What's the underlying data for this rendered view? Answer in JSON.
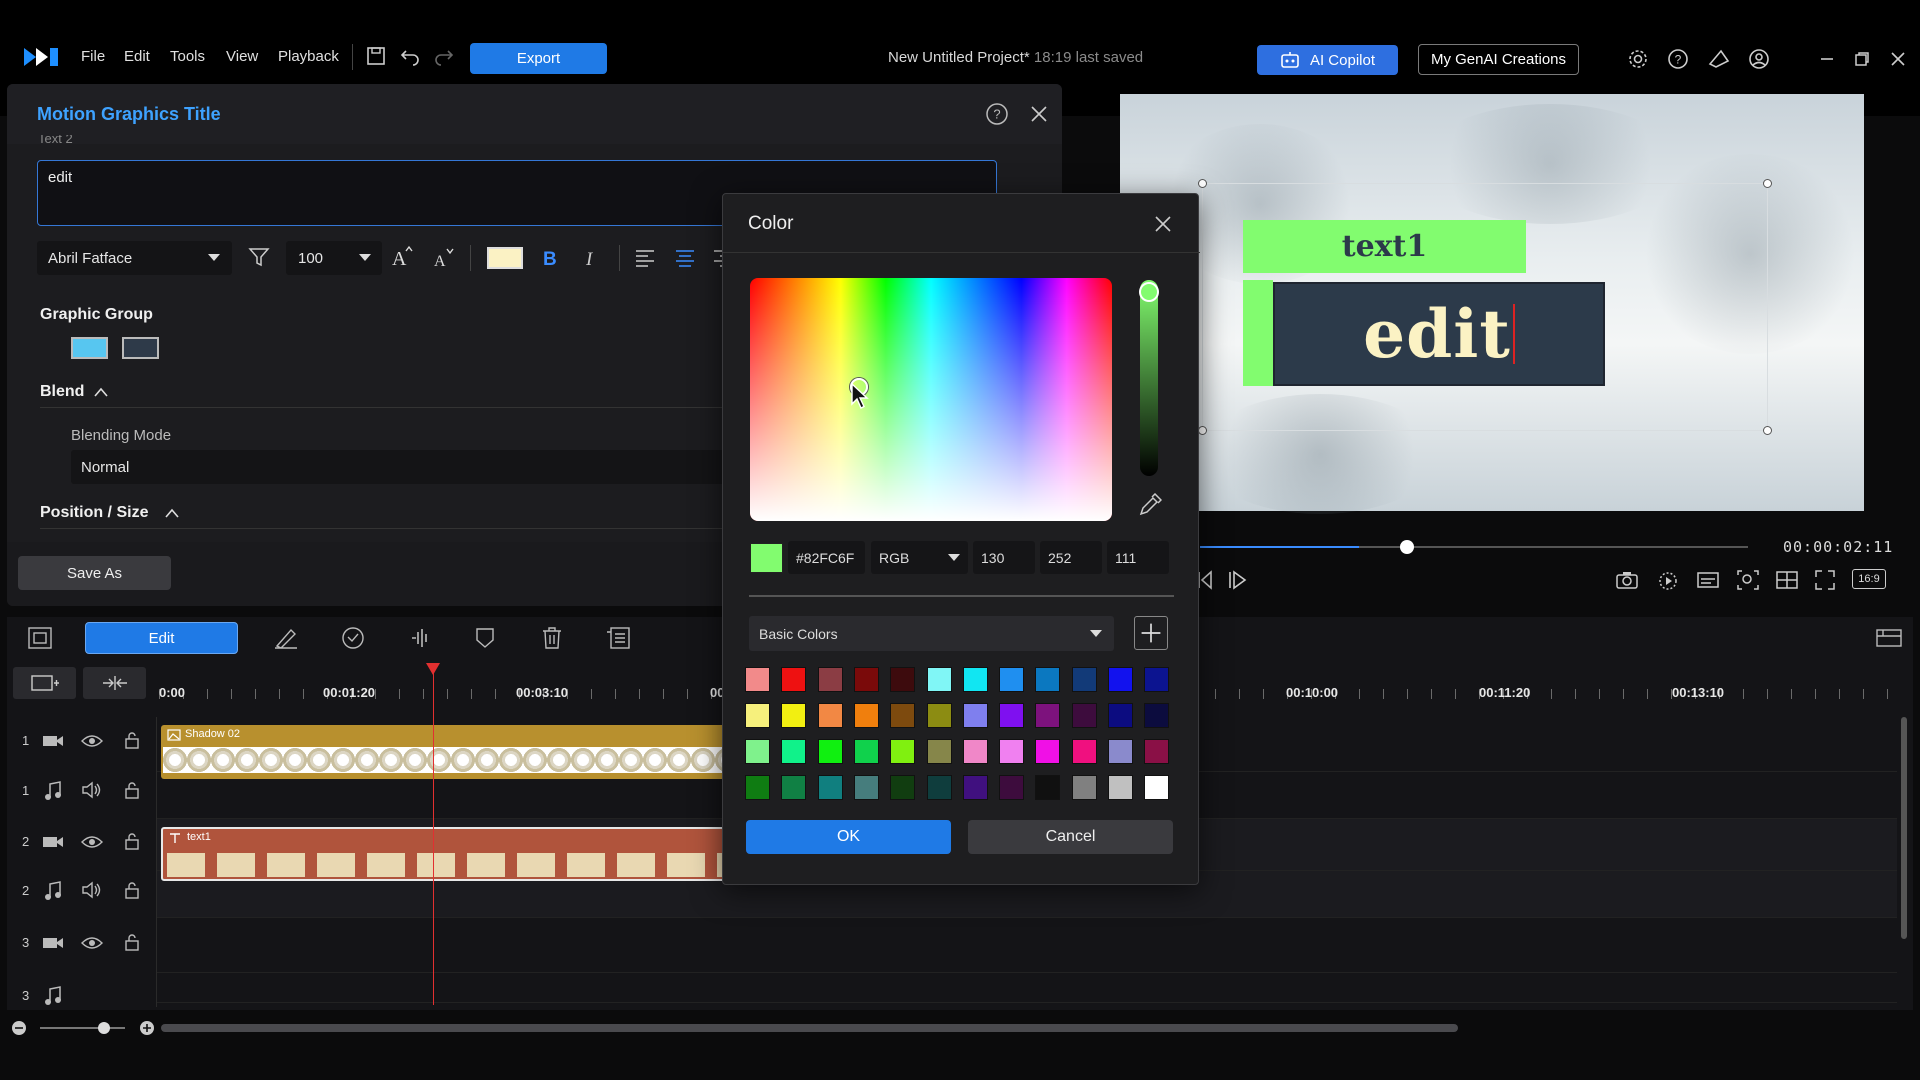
{
  "menu": {
    "file": "File",
    "edit": "Edit",
    "tools": "Tools",
    "view": "View",
    "playback": "Playback"
  },
  "toolbar": {
    "export_label": "Export"
  },
  "project": {
    "name": "New Untitled Project*",
    "saved": "18:19 last saved"
  },
  "header": {
    "ai_copilot": "AI Copilot",
    "my_genai": "My GenAI Creations"
  },
  "panel": {
    "title": "Motion Graphics Title",
    "text_label": "Text 2",
    "text_value": "edit",
    "font": "Abril Fatface",
    "font_size": "100",
    "graphic_group": "Graphic Group",
    "blend": "Blend",
    "blending_mode_label": "Blending Mode",
    "blending_mode_value": "Normal",
    "position_size": "Position / Size",
    "save_as": "Save As"
  },
  "preview": {
    "text1": "text1",
    "text2": "edit",
    "timecode": "00:00:02:11",
    "aspect": "16:9",
    "progress": 0.4
  },
  "timeline": {
    "edit_label": "Edit",
    "ticks": [
      "0:00",
      "00:01:20",
      "00:03:10",
      "00",
      "00:10:00",
      "00:11:20",
      "00:13:10"
    ],
    "tracks": [
      {
        "num": "1",
        "kind": "video"
      },
      {
        "num": "1",
        "kind": "audio"
      },
      {
        "num": "2",
        "kind": "video"
      },
      {
        "num": "2",
        "kind": "audio"
      },
      {
        "num": "3",
        "kind": "video"
      },
      {
        "num": "3",
        "kind": "audio"
      }
    ],
    "clip1": "Shadow 02",
    "clip2": "text1",
    "clip2_thumb": "edit"
  },
  "color_dialog": {
    "title": "Color",
    "hex": "#82FC6F",
    "mode": "RGB",
    "r": "130",
    "g": "252",
    "b": "111",
    "palette_label": "Basic Colors",
    "ok": "OK",
    "cancel": "Cancel",
    "current_color": "#82FC6F",
    "swatches": [
      [
        "#f28a8a",
        "#ee1111",
        "#8b3d44",
        "#7a0a0a",
        "#3d0b0d",
        "#80f6f6",
        "#11e6f2",
        "#1f8ff0",
        "#0b78c0",
        "#123a78",
        "#1212ee",
        "#0c1490"
      ],
      [
        "#f6f07c",
        "#f2ef11",
        "#f28844",
        "#f07f0d",
        "#7d4a0e",
        "#8c8c12",
        "#7f7fee",
        "#7f10f0",
        "#7d127d",
        "#3d0c3d",
        "#0c0c80",
        "#0c0c3e"
      ],
      [
        "#7ff28c",
        "#10f28a",
        "#10f010",
        "#10d14c",
        "#80f010",
        "#86864a",
        "#f087c8",
        "#f080f0",
        "#f010e6",
        "#f0107f",
        "#8a8acc",
        "#8a1046"
      ],
      [
        "#0f7c12",
        "#108044",
        "#107f7f",
        "#467d7d",
        "#113d10",
        "#0f3d3d",
        "#40107f",
        "#3d0c3d",
        "#101010",
        "#808080",
        "#c0c0c0",
        "#ffffff"
      ]
    ]
  }
}
